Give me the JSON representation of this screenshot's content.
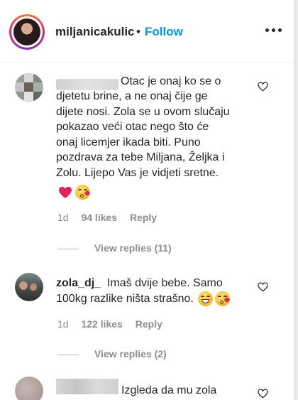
{
  "header": {
    "username": "miljanicakulic",
    "separator": "•",
    "follow_label": "Follow",
    "more_icon": "more-horizontal-icon"
  },
  "comments": [
    {
      "username_visible": false,
      "lines": [
        "Otac je onaj ko se o",
        "djetetu brine, a ne onaj čije ge",
        "dijete nosi. Zola se u ovom slučaju",
        "pokazao veći otac nego što će",
        "onaj licemjer ikada biti. Puno",
        "pozdrava za tebe Miljana, Željka i",
        "Zolu. Lijepo Vas je vidjeti sretne."
      ],
      "emojis": [
        "red-heart-emoji",
        "face-blowing-kiss-emoji"
      ],
      "age": "1d",
      "likes": "94 likes",
      "reply_label": "Reply",
      "view_replies": "View replies (11)"
    },
    {
      "username": "zola_dj_",
      "lines": [
        "Imaš dvije bebe. Samo",
        "100kg razlike ništa strašno."
      ],
      "emojis": [
        "grinning-face-emoji",
        "face-blowing-kiss-emoji"
      ],
      "age": "1d",
      "likes": "122 likes",
      "reply_label": "Reply",
      "view_replies": "View replies (2)"
    },
    {
      "username_visible": false,
      "lines": [
        "Izgleda da mu zola"
      ]
    }
  ],
  "colors": {
    "accent": "#0095f6",
    "text": "#262626",
    "muted": "#8e8e8e",
    "heart": "#e0245e"
  }
}
